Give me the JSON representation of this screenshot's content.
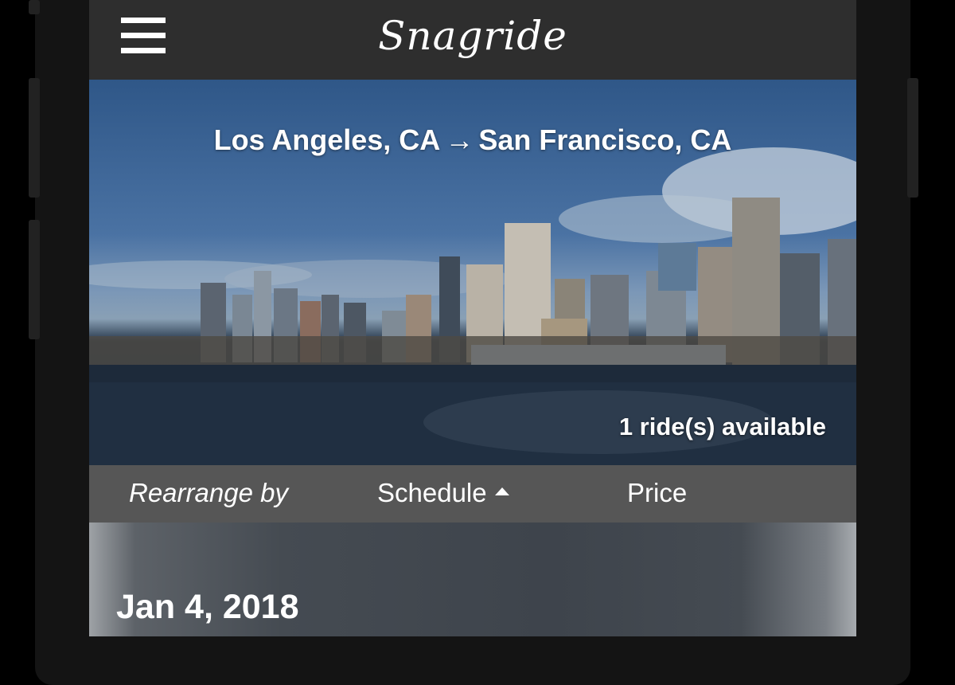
{
  "header": {
    "logo_text": "Snagride",
    "menu_icon": "hamburger-menu-icon"
  },
  "hero": {
    "origin": "Los Angeles, CA",
    "arrow": "→",
    "destination": "San Francisco, CA",
    "rides_available": "1 ride(s) available"
  },
  "sort": {
    "label": "Rearrange by",
    "schedule": "Schedule",
    "price": "Price",
    "active": "Schedule",
    "direction_icon": "triangle-up-icon"
  },
  "results": {
    "date": "Jan 4, 2018"
  },
  "colors": {
    "topbar": "#2e2e2e",
    "sortbar": "#565656",
    "text": "#ffffff"
  }
}
